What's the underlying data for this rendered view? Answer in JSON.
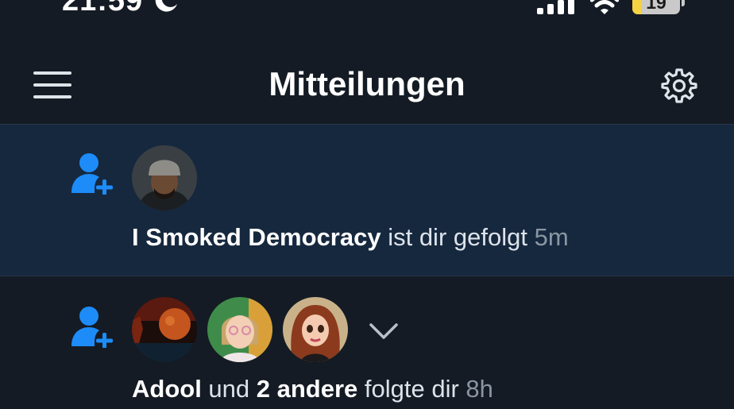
{
  "status_bar": {
    "time": "21:59",
    "moon_icon": "moon-icon",
    "battery_percent": "19",
    "battery_level": 0.19,
    "colors": {
      "battery": "#f5d442"
    }
  },
  "header": {
    "title": "Mitteilungen",
    "menu_icon": "hamburger-menu-icon",
    "settings_icon": "gear-icon"
  },
  "notifications": [
    {
      "icon": "person-add-icon",
      "unread": true,
      "actor": "I Smoked Democracy",
      "text": " ist dir gefolgt ",
      "time": "5m"
    },
    {
      "icon": "person-add-icon",
      "unread": false,
      "actor": "Adool",
      "connector": " und ",
      "others": "2 andere",
      "text": " folgte dir ",
      "time": "8h",
      "expand_icon": "chevron-down-icon"
    }
  ],
  "colors": {
    "background": "#141b24",
    "unread_background": "#16283e",
    "accent": "#1d8cf8",
    "timestamp": "#8a96a3"
  }
}
